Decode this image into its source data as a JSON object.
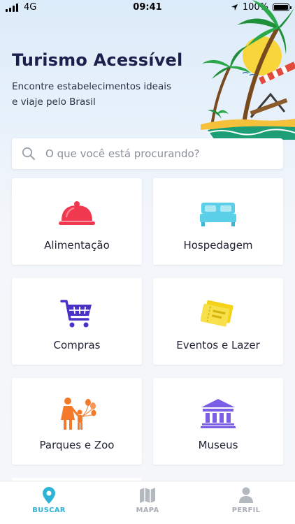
{
  "status_bar": {
    "carrier": "4G",
    "time": "09:41",
    "battery": "100%"
  },
  "header": {
    "title": "Turismo Acessível",
    "subtitle": "Encontre estabelecimentos ideais e viaje pelo Brasil"
  },
  "search": {
    "placeholder": "O que você está procurando?",
    "value": ""
  },
  "categories": [
    {
      "label": "Alimentação",
      "icon": "cloche-icon",
      "color": "#f0384f"
    },
    {
      "label": "Hospedagem",
      "icon": "bed-icon",
      "color": "#5ccfe8"
    },
    {
      "label": "Compras",
      "icon": "shopping-cart-icon",
      "color": "#4a32c8"
    },
    {
      "label": "Eventos e Lazer",
      "icon": "ticket-icon",
      "color": "#f5d216"
    },
    {
      "label": "Parques e Zoo",
      "icon": "family-balloons-icon",
      "color": "#f47a29"
    },
    {
      "label": "Museus",
      "icon": "museum-icon",
      "color": "#7b5ee5"
    }
  ],
  "tabbar": {
    "tabs": [
      {
        "label": "BUSCAR",
        "icon": "location-pin-icon",
        "active": true
      },
      {
        "label": "MAPA",
        "icon": "map-icon",
        "active": false
      },
      {
        "label": "PERFIL",
        "icon": "person-icon",
        "active": false
      }
    ],
    "active_color": "#2fb4d6",
    "inactive_color": "#a9adb5"
  }
}
